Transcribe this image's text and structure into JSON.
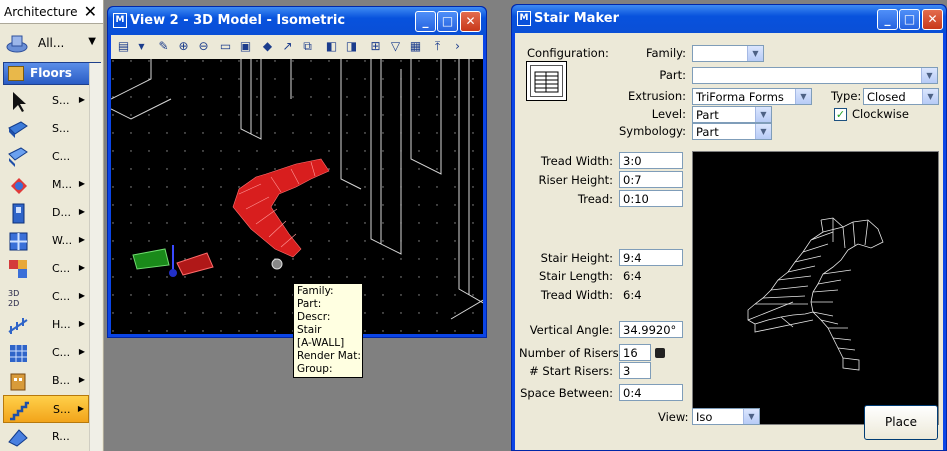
{
  "palette": {
    "title": "Architecture",
    "close_glyph": "✕",
    "dropdown_label": "All...",
    "tab_label": "Floors",
    "tools": [
      {
        "label": "S...",
        "icon": "select-arrow-icon",
        "submenu": true
      },
      {
        "label": "S...",
        "icon": "slab-icon",
        "submenu": false
      },
      {
        "label": "C...",
        "icon": "ceiling-icon",
        "submenu": false
      },
      {
        "label": "M...",
        "icon": "modify-icon",
        "submenu": true
      },
      {
        "label": "D...",
        "icon": "door-icon",
        "submenu": true
      },
      {
        "label": "W...",
        "icon": "window-icon",
        "submenu": true
      },
      {
        "label": "C...",
        "icon": "components-icon",
        "submenu": true
      },
      {
        "label": "C...",
        "icon": "coordinates-icon",
        "submenu": true
      },
      {
        "label": "H...",
        "icon": "handrail-icon",
        "submenu": true
      },
      {
        "label": "C...",
        "icon": "curtain-wall-icon",
        "submenu": true
      },
      {
        "label": "B...",
        "icon": "building-icon",
        "submenu": true
      },
      {
        "label": "S...",
        "icon": "stair-icon",
        "submenu": true,
        "selected": true
      },
      {
        "label": "R...",
        "icon": "roof-icon",
        "submenu": false
      }
    ]
  },
  "view2": {
    "title": "View 2 - 3D Model - Isometric",
    "app_glyph": "M",
    "tooltip": [
      "Family:",
      "Part:",
      "Descr:",
      "Stair",
      "[A-WALL]",
      "Render Mat:",
      "Group:"
    ]
  },
  "stair_maker": {
    "title": "Stair Maker",
    "config_label": "Configuration:",
    "family_label": "Family:",
    "family_value": "",
    "part_label": "Part:",
    "part_value": "",
    "extrusion_label": "Extrusion:",
    "extrusion_value": "TriForma Forms",
    "type_label": "Type:",
    "type_value": "Closed",
    "level_label": "Level:",
    "level_value": "Part",
    "clockwise_label": "Clockwise",
    "symbology_label": "Symbology:",
    "symbology_value": "Part",
    "tread_width_label": "Tread Width:",
    "tread_width_value": "3:0",
    "riser_height_label": "Riser Height:",
    "riser_height_value": "0:7",
    "tread_label": "Tread:",
    "tread_value": "0:10",
    "stair_height_label": "Stair Height:",
    "stair_height_value": "9:4",
    "stair_length_label": "Stair Length:",
    "stair_length_value": "6:4",
    "tread_width2_label": "Tread Width:",
    "tread_width2_value": "6:4",
    "vertical_angle_label": "Vertical Angle:",
    "vertical_angle_value": "34.9920°",
    "num_risers_label": "Number of Risers:",
    "num_risers_value": "16",
    "start_risers_label": "# Start Risers:",
    "start_risers_value": "3",
    "space_between_label": "Space Between:",
    "space_between_value": "0:4",
    "view_label": "View:",
    "view_value": "Iso",
    "place_label": "Place"
  }
}
